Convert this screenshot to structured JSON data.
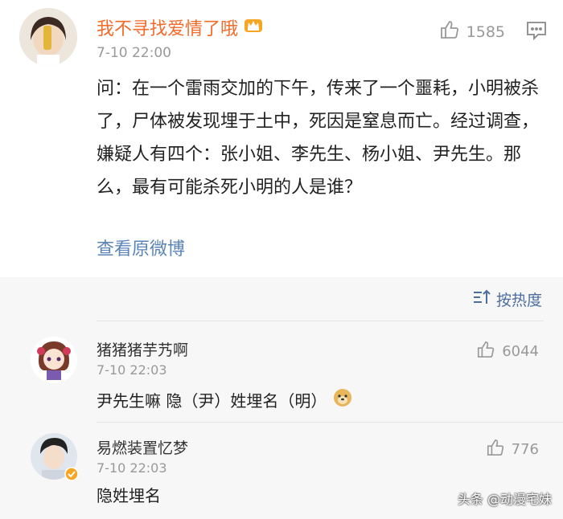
{
  "post": {
    "author": "我不寻找爱情了哦",
    "time": "7-10 22:00",
    "likes": "1585",
    "body": "问：在一个雷雨交加的下午，传来了一个噩耗，小明被杀了，尸体被发现埋于土中，死因是窒息而亡。经过调查，嫌疑人有四个：张小姐、李先生、杨小姐、尹先生。那么，最有可能杀死小明的人是谁？",
    "link": "查看原微博"
  },
  "comments_section": {
    "sort_label": "按热度",
    "items": [
      {
        "author": "猪猪猪芋艿啊",
        "time": "7-10 22:03",
        "likes": "6044",
        "text": "尹先生嘛 隐（尹）姓埋名（明）"
      },
      {
        "author": "易燃装置忆梦",
        "time": "7-10 22:03",
        "likes": "776",
        "text": "隐姓埋名"
      }
    ]
  },
  "watermark": "头条 @动漫宅妹",
  "icons": [
    "crown-badge-icon",
    "thumb-up-icon",
    "comment-icon",
    "sort-icon",
    "doge-emoji-icon",
    "verified-badge-icon"
  ],
  "colors": {
    "author_name": "#f26b2a",
    "link": "#5a84b8",
    "sort": "#4d6e9c",
    "muted": "#999999"
  }
}
